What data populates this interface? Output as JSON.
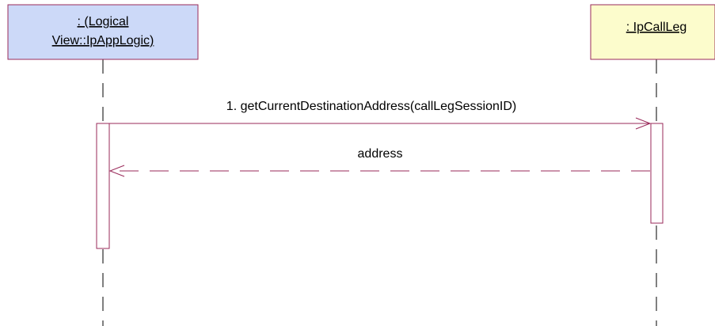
{
  "diagram": {
    "participants": [
      {
        "id": "app_logic",
        "label_lines": [
          ": (Logical",
          "View::IpAppLogic)"
        ],
        "fill": "#ccd9f8",
        "stroke": "#9a2a5a"
      },
      {
        "id": "call_leg",
        "label_lines": [
          ": IpCallLeg"
        ],
        "fill": "#fcfccc",
        "stroke": "#9a2a5a"
      }
    ],
    "messages": [
      {
        "label": "1. getCurrentDestinationAddress(callLegSessionID)",
        "kind": "call",
        "from": "app_logic",
        "to": "call_leg"
      },
      {
        "label": "address",
        "kind": "return",
        "from": "call_leg",
        "to": "app_logic"
      }
    ],
    "line_color": "#9a2a5a",
    "lifeline_color": "#000000"
  }
}
